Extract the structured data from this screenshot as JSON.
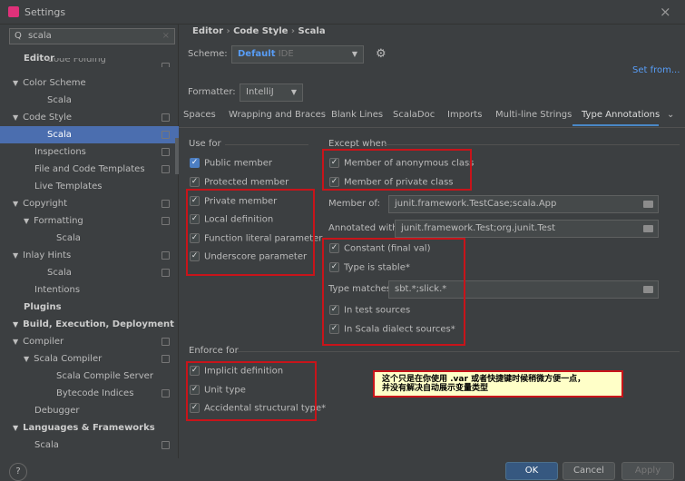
{
  "window": {
    "title": "Settings",
    "close": "×"
  },
  "search": {
    "value": "scala",
    "clear": "×"
  },
  "sidebar": {
    "items": [
      {
        "label": "Editor",
        "top": "64"
      },
      {
        "label": "Code Folding"
      },
      {
        "label": "Color Scheme"
      },
      {
        "label": "Scala"
      },
      {
        "label": "Code Style"
      },
      {
        "label": "Scala"
      },
      {
        "label": "Inspections"
      },
      {
        "label": "File and Code Templates"
      },
      {
        "label": "Live Templates"
      },
      {
        "label": "Copyright"
      },
      {
        "label": "Formatting"
      },
      {
        "label": "Scala"
      },
      {
        "label": "Inlay Hints"
      },
      {
        "label": "Scala"
      },
      {
        "label": "Intentions"
      },
      {
        "label": "Plugins"
      },
      {
        "label": "Build, Execution, Deployment"
      },
      {
        "label": "Compiler"
      },
      {
        "label": "Scala Compiler"
      },
      {
        "label": "Scala Compile Server"
      },
      {
        "label": "Bytecode Indices"
      },
      {
        "label": "Debugger"
      },
      {
        "label": "Languages & Frameworks"
      },
      {
        "label": "Scala"
      }
    ]
  },
  "breadcrumb": [
    "Editor",
    "Code Style",
    "Scala"
  ],
  "scheme": {
    "label": "Scheme:",
    "name": "Default",
    "kind": "IDE"
  },
  "set_from": "Set from...",
  "formatter": {
    "label": "Formatter:",
    "value": "IntelliJ"
  },
  "tabs": [
    "Spaces",
    "Wrapping and Braces",
    "Blank Lines",
    "ScalaDoc",
    "Imports",
    "Multi-line Strings",
    "Type Annotations"
  ],
  "active_tab": "Type Annotations",
  "use_for": {
    "title": "Use for",
    "items": [
      "Public member",
      "Protected member",
      "Private member",
      "Local definition",
      "Function literal parameter",
      "Underscore parameter"
    ]
  },
  "except_when": {
    "title": "Except when",
    "items": [
      "Member of anonymous class",
      "Member of private class"
    ],
    "member_of": {
      "label": "Member of:",
      "value": "junit.framework.TestCase;scala.App"
    },
    "annotated_with": {
      "label": "Annotated with:",
      "value": "junit.framework.Test;org.junit.Test"
    },
    "items2": [
      "Constant (final val)",
      "Type is stable*"
    ],
    "type_matches": {
      "label": "Type matches:",
      "value": "sbt.*;slick.*"
    },
    "items3": [
      "In test sources",
      "In Scala dialect sources*"
    ]
  },
  "enforce_for": {
    "title": "Enforce for",
    "items": [
      "Implicit definition",
      "Unit type",
      "Accidental structural type*"
    ]
  },
  "note": {
    "line1": "这个只是在你使用 .var 或者快捷键时候稍微方便一点，",
    "line2": "并没有解决自动展示变量类型"
  },
  "buttons": {
    "ok": "OK",
    "cancel": "Cancel",
    "apply": "Apply",
    "help": "?"
  },
  "colors": {
    "accent": "#4b6eaf",
    "link": "#589df6",
    "annotation": "#c8141a"
  }
}
